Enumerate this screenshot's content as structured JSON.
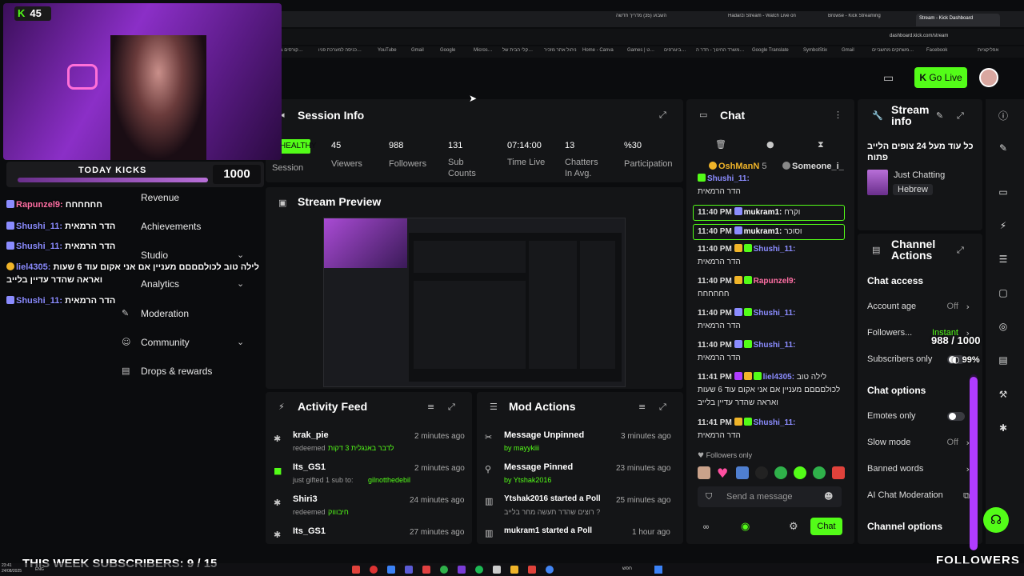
{
  "browser": {
    "tabs": [
      "השבוע (35) מדריך חדשה",
      "Hadarzi Stream - Watch Live on",
      "Browse - Kick Streaming",
      "Stream - Kick Dashboard"
    ],
    "url": "dashboard.kick.com/stream",
    "bookmarks": [
      "קורסים ב…",
      "כניסה למערכת פניו…",
      "YouTube",
      "Gmail",
      "Google",
      "Micros…",
      "קלי הבית של…",
      "ניהול אתר מזכיר",
      "Home - Canva",
      "Games | ט…",
      "ביוגרפים…",
      "משרד החינוך - חדר ה…",
      "Google Translate",
      "SymbolStix",
      "Gmail",
      "משחקים מחשביים…",
      "Facebook",
      "אפליקציות"
    ]
  },
  "header": {
    "go_live": "Go Live"
  },
  "overlay": {
    "kicks_count": "45",
    "today_kicks_label": "TODAY KICKS",
    "today_kicks_value": "1000",
    "chat": [
      {
        "user": "Rapunzel9:",
        "text": "חחחחחח"
      },
      {
        "user": "Shushi_11:",
        "text": "הדר הרמאית"
      },
      {
        "user": "Shushi_11:",
        "text": "הדר הרמאית"
      },
      {
        "user": "liel4305:",
        "text": "לילה טוב לכולםםםם מעניין אם אני אקום עוד 6 שעות"
      },
      {
        "user": "",
        "text": "ואראה שהדר עדיין בלייב"
      },
      {
        "user": "Shushi_11:",
        "text": "הדר הרמאית"
      }
    ],
    "week_subs": "THIS WEEK SUBSCRIBERS: 9 / 15",
    "followers_label": "FOLLOWERS",
    "followers_goal": "988 / 1000",
    "followers_pct": "99%",
    "followers_fraction": 0.988
  },
  "sidebar": {
    "items": [
      {
        "label": "Revenue"
      },
      {
        "label": "Achievements"
      },
      {
        "label": "Studio"
      },
      {
        "label": "Analytics"
      },
      {
        "label": "Moderation"
      },
      {
        "label": "Community"
      },
      {
        "label": "Drops & rewards"
      }
    ]
  },
  "session": {
    "title": "Session Info",
    "health": "HEALTHY",
    "session_label": "Session",
    "stats": [
      {
        "value": "45",
        "label": "Viewers"
      },
      {
        "value": "988",
        "label": "Followers"
      },
      {
        "value": "131",
        "label": "Sub Counts"
      },
      {
        "value": "07:14:00",
        "label": "Time Live"
      },
      {
        "value": "13",
        "label": "Chatters In Avg."
      },
      {
        "value": "%30",
        "label": "Participation"
      }
    ]
  },
  "preview": {
    "title": "Stream Preview"
  },
  "activity": {
    "title": "Activity Feed",
    "items": [
      {
        "name": "krak_pie",
        "action": "redeemed",
        "detail": "לדבר באנגלית 3 דקות",
        "time": "2 minutes ago"
      },
      {
        "name": "Its_GS1",
        "action": "just gifted 1 sub to:",
        "detail": "gilnotthedebil",
        "time": "2 minutes ago"
      },
      {
        "name": "Shiri3",
        "action": "redeemed",
        "detail": "חיבוווק",
        "time": "24 minutes ago"
      },
      {
        "name": "Its_GS1",
        "action": "",
        "detail": "",
        "time": "27 minutes ago"
      }
    ]
  },
  "mod": {
    "title": "Mod Actions",
    "items": [
      {
        "name": "Message Unpinned",
        "by": "by mayykiii",
        "time": "3 minutes ago"
      },
      {
        "name": "Message Pinned",
        "by": "by Ytshak2016",
        "time": "23 minutes ago"
      },
      {
        "name": "Ytshak2016 started a Poll",
        "by": "רוצים שהדר תעשה מחר בלייב ?",
        "time": "25 minutes ago"
      },
      {
        "name": "mukram1 started a Poll",
        "by": "",
        "time": "1 hour ago"
      }
    ]
  },
  "chat": {
    "title": "Chat",
    "top_users": [
      {
        "name": "OshManN",
        "count": "5"
      },
      {
        "name": "Someone_i_"
      }
    ],
    "messages": [
      {
        "time": "",
        "user": "Shushi_11:",
        "text": "הדר הרמאית",
        "color": "blue"
      },
      {
        "time": "11:40 PM",
        "user": "mukram1:",
        "text": "וקרח",
        "color": "white"
      },
      {
        "time": "11:40 PM",
        "user": "mukram1:",
        "text": "וסוכר",
        "color": "white"
      },
      {
        "time": "11:40 PM",
        "user": "Shushi_11:",
        "text": "הדר הרמאית",
        "color": "blue"
      },
      {
        "time": "11:40 PM",
        "user": "Rapunzel9:",
        "text": "חחחחחח",
        "color": "pink"
      },
      {
        "time": "11:40 PM",
        "user": "Shushi_11:",
        "text": "הדר הרמאית",
        "color": "blue"
      },
      {
        "time": "11:40 PM",
        "user": "Shushi_11:",
        "text": "הדר הרמאית",
        "color": "blue"
      },
      {
        "time": "11:41 PM",
        "user": "liel4305:",
        "text": "לילה טוב לכולםםםם מעניין אם אני אקום עוד 6 שעות ואראה שהדר עדיין בלייב",
        "color": "blue"
      },
      {
        "time": "11:41 PM",
        "user": "Shushi_11:",
        "text": "הדר הרמאית",
        "color": "blue"
      }
    ],
    "followers_only": "Followers only",
    "placeholder": "Send a message",
    "send": "Chat"
  },
  "stream_info": {
    "title": "Stream info",
    "stream_title": "כל עוד מעל 24 צופים הלייב פתוח",
    "category": "Just Chatting",
    "language": "Hebrew"
  },
  "channel_actions": {
    "title": "Channel Actions",
    "chat_access": "Chat access",
    "rows": [
      {
        "label": "Account age",
        "value": "Off"
      },
      {
        "label": "Followers...",
        "value": "Instant"
      },
      {
        "label": "Subscribers only",
        "value": ""
      }
    ],
    "chat_options": "Chat options",
    "rows2": [
      {
        "label": "Emotes only",
        "value": ""
      },
      {
        "label": "Slow mode",
        "value": "Off"
      },
      {
        "label": "Banned words",
        "value": ""
      },
      {
        "label": "AI Chat Moderation",
        "value": ""
      }
    ],
    "channel_options": "Channel options"
  },
  "taskbar": {
    "time": "23:41",
    "date": "24/08/2025",
    "lang": "ENG",
    "search": "חפש"
  },
  "colors": {
    "kick_green": "#53fc18",
    "accent_purple": "#b03cff",
    "panel": "#141517"
  }
}
